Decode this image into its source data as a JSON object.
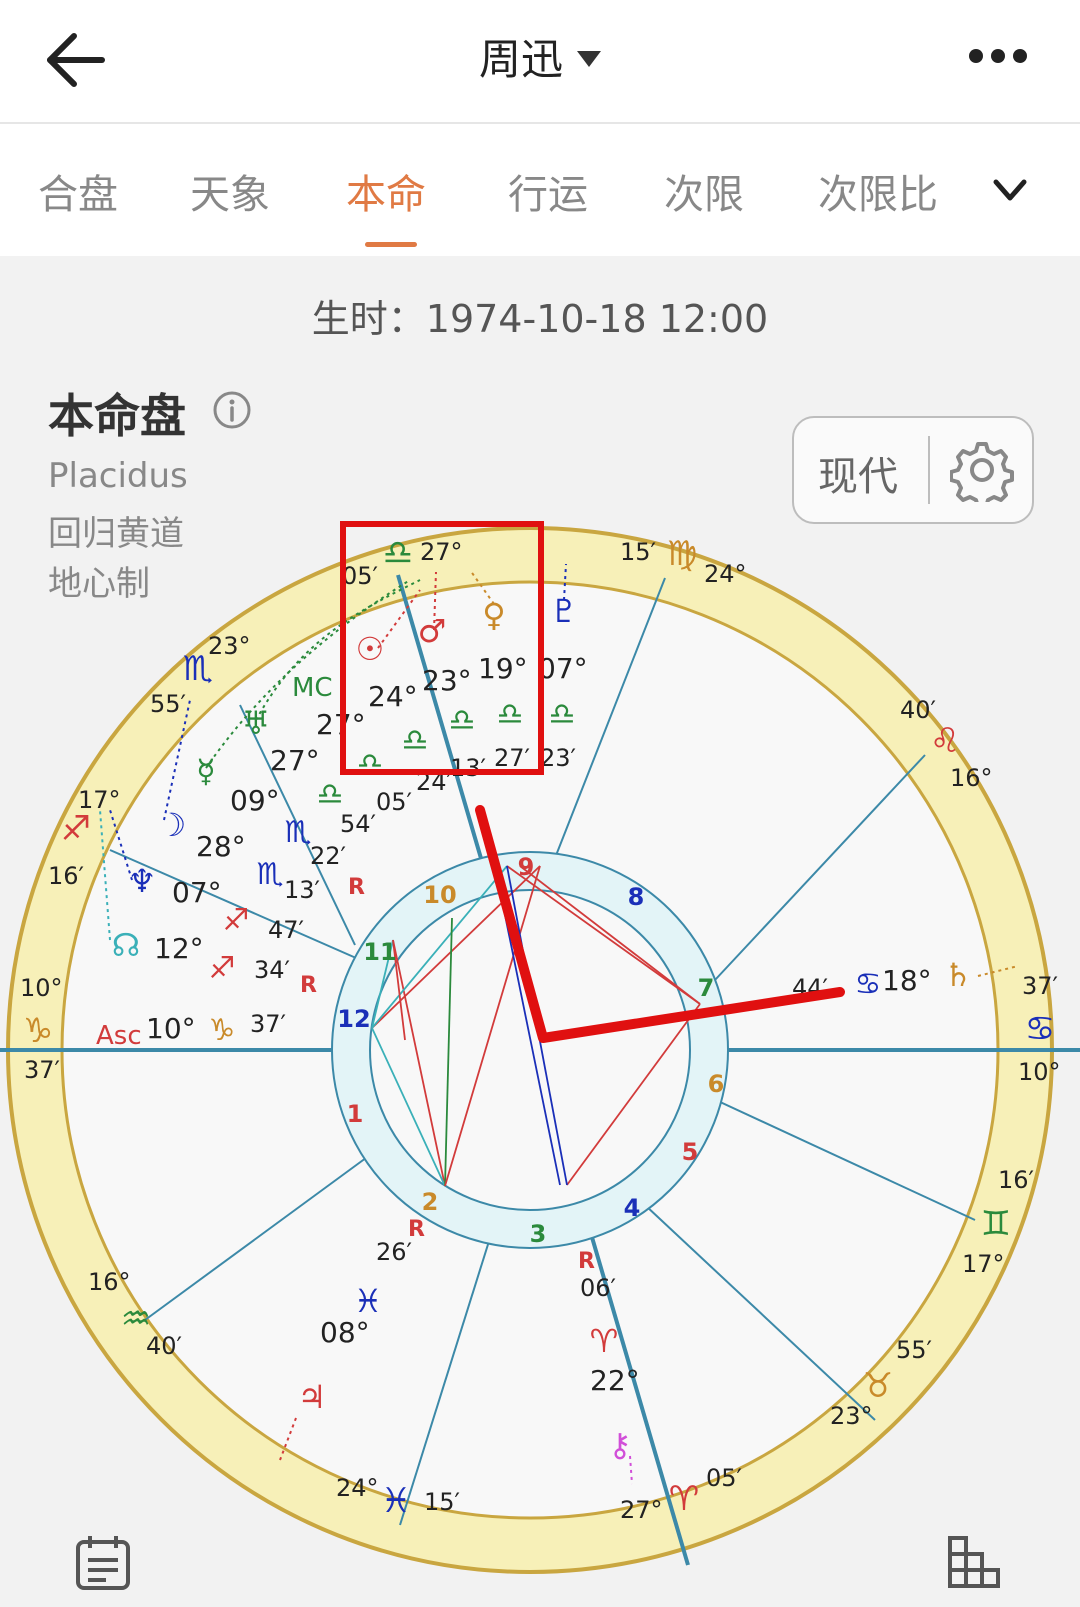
{
  "header": {
    "title": "周迅"
  },
  "tabs": [
    {
      "label": "合盘",
      "active": false
    },
    {
      "label": "天象",
      "active": false
    },
    {
      "label": "本命",
      "active": true
    },
    {
      "label": "行运",
      "active": false
    },
    {
      "label": "次限",
      "active": false
    },
    {
      "label": "次限比",
      "active": false
    }
  ],
  "birth_time": "生时：1974-10-18 12:00",
  "chart": {
    "title": "本命盘",
    "house_system": "Placidus",
    "zodiac": "回归黄道",
    "center": "地心制",
    "mode": "现代"
  },
  "wheel": {
    "cusp_labels": {
      "top_sign_deg": "27°",
      "top_sign_min": "05′",
      "virgo_min": "15′",
      "virgo_deg": "24°",
      "leo_min": "40′",
      "leo_deg": "16°",
      "scorpio_deg": "23°",
      "scorpio_min": "55′",
      "sag_deg": "17°",
      "sag_min": "16′",
      "cap_deg": "10°",
      "cap_min": "37′",
      "cancer_min": "37′",
      "cancer_deg": "10°",
      "gemini_min": "16′",
      "gemini_deg": "17°",
      "aquarius_deg": "16°",
      "aquarius_min": "40′",
      "taurus_min": "55′",
      "taurus_deg": "23°",
      "pisces_deg": "24°",
      "pisces_min": "15′",
      "aries_deg": "27°",
      "aries_min": "05′"
    },
    "planet_labels": {
      "mc": "MC",
      "asc": "Asc",
      "sun_deg": "24°",
      "mars_deg": "23°",
      "venus_deg": "19°",
      "pluto_deg": "07°",
      "sun_min": "05′",
      "mars_min": "24′",
      "venus_min": "13′",
      "venus2_min": "27′",
      "pluto_min": "23′",
      "uranus_deg": "27°",
      "mercury_deg": "27°",
      "mercury_deg2": "09°",
      "mercury_min": "54′",
      "moon_deg": "28°",
      "moon_min": "22′",
      "neptune_deg": "07°",
      "neptune_min": "13′",
      "node_deg": "12°",
      "node_min": "47′",
      "node_min2": "34′",
      "asc_deg": "10°",
      "asc_min": "37′",
      "saturn_min": "44′",
      "saturn_deg": "18°",
      "jupiter_deg": "08°",
      "jupiter_min": "26′",
      "chiron_deg": "22°",
      "chiron_min": "06′",
      "retro": "R"
    },
    "house_numbers": [
      "1",
      "2",
      "3",
      "4",
      "5",
      "6",
      "7",
      "8",
      "9",
      "10",
      "11",
      "12"
    ]
  },
  "colors": {
    "accent": "#e07a44",
    "ring": "#f7f0b8",
    "ring_border": "#c9a640",
    "house_ring": "#e3f4f7",
    "house_line": "#3c89a8",
    "highlight": "#e01010"
  },
  "icons": [
    "back-arrow-icon",
    "caret-down-icon",
    "more-dots-icon",
    "chevron-down-icon",
    "info-icon",
    "gear-icon",
    "calendar-list-icon",
    "grid-chart-icon"
  ]
}
